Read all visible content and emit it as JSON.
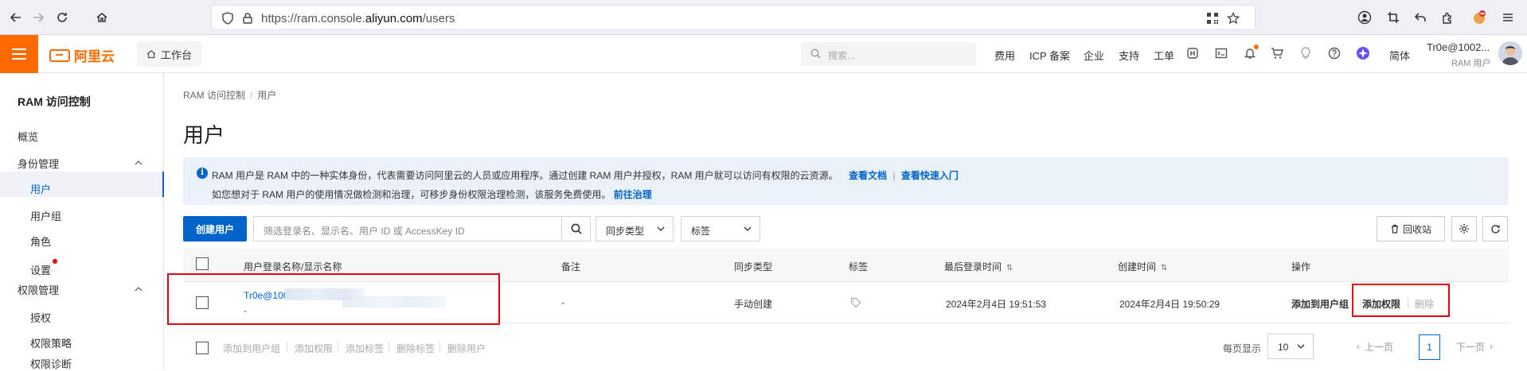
{
  "browser": {
    "url_prefix": "https://ram.console.",
    "url_domain": "aliyun.com",
    "url_path": "/users"
  },
  "topnav": {
    "logo_text": "阿里云",
    "workbench": "工作台",
    "search_placeholder": "搜索...",
    "links": [
      "费用",
      "ICP 备案",
      "企业",
      "支持",
      "工单"
    ],
    "language": "简体",
    "user_name": "Tr0e@1002...",
    "user_role": "RAM 用户",
    "accent": "#ff6a00"
  },
  "sidebar": {
    "title": "RAM 访问控制",
    "overview": "概览",
    "identity_group": "身份管理",
    "users": "用户",
    "user_groups": "用户组",
    "roles": "角色",
    "settings": "设置",
    "permission_group": "权限管理",
    "grant": "授权",
    "policies": "权限策略",
    "diagnosis": "权限诊断"
  },
  "main": {
    "breadcrumb_root": "RAM 访问控制",
    "breadcrumb_current": "用户",
    "title": "用户",
    "info_line1": "RAM 用户是 RAM 中的一种实体身份，代表需要访问阿里云的人员或应用程序。通过创建 RAM 用户并授权，RAM 用户就可以访问有权限的云资源。",
    "info_link1": "查看文档",
    "info_link_sep": "|",
    "info_link2": "查看快速入门",
    "info_line2": "如您想对于 RAM 用户的使用情况做检测和治理，可移步身份权限治理检测，该服务免费使用。",
    "info_link3": "前往治理",
    "create_button": "创建用户",
    "filter_placeholder": "筛选登录名、显示名、用户 ID 或 AccessKey ID",
    "sync_type_select": "同步类型",
    "tag_select": "标签",
    "recycle_button": "回收站",
    "columns": {
      "name": "用户登录名称/显示名称",
      "note": "备注",
      "sync": "同步类型",
      "tag": "标签",
      "last_login": "最后登录时间",
      "created": "创建时间",
      "actions": "操作"
    },
    "rows": [
      {
        "login": "Tr0e@100",
        "display": "-",
        "note": "-",
        "sync": "手动创建",
        "last_login": "2024年2月4日 19:51:53",
        "created": "2024年2月4日 19:50:29",
        "action_add_group": "添加到用户组",
        "action_add_perm": "添加权限",
        "action_delete": "删除"
      }
    ],
    "bulk_actions": [
      "添加到用户组",
      "添加权限",
      "添加标签",
      "删除标签",
      "删除用户"
    ],
    "page_size_label": "每页显示",
    "page_size": "10",
    "prev_page": "上一页",
    "current_page": "1",
    "next_page": "下一页"
  }
}
